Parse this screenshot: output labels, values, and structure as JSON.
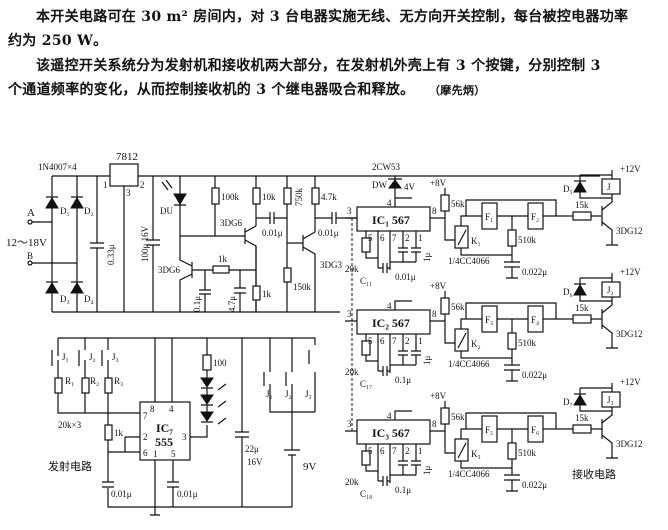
{
  "text": {
    "p1a": "本开关电路可在 30 m² 房间内，对 3 台电器实施无线、无方向开关控制，每台被控电器功率",
    "p1b": "约为 250 W。",
    "p2a": "该遥控开关系统分为发射机和接收机两大部分，在发射机外壳上有 3 个按键，分别控制 3",
    "p2b": "个通道频率的变化，从而控制接收机的 3 个继电器吸合和释放。",
    "author": "（摩先炳）"
  },
  "power": {
    "bridge": "1N4007×4",
    "regulator": "7812",
    "pin1": "1",
    "pin2": "2",
    "pin3": "3",
    "a": "A",
    "b": "B",
    "input_voltage": "12～18V",
    "d1": "D₁",
    "d2": "D₂",
    "d3": "D₃",
    "d4": "D₄",
    "c033": "0.33μ",
    "c100": "100μ 16V",
    "du": "DU",
    "r100k": "100k",
    "r10k": "10k",
    "r750k": "750k",
    "r47k": "4.7k",
    "q1": "3DG6",
    "q2": "3DG6",
    "q3": "3DG3",
    "c001a": "0.01μ",
    "c001b": "0.01μ",
    "r1k_h": "1k",
    "c01": "0.1μ",
    "c47": "4.7μ",
    "r1k_v": "1k",
    "r150k": "150k"
  },
  "receiver": {
    "zener": "2CW53",
    "dw": "DW",
    "zener_v": "4V",
    "caption": "接收电路",
    "rows": [
      {
        "ic": "IC₁ 567",
        "supply": "+8V",
        "p3": "3",
        "p8": "8",
        "p4": "4",
        "p5": "5",
        "p6": "6",
        "p7": "7",
        "p2": "2",
        "p1": "1",
        "pot": "20k",
        "c_timing": "C₁₁",
        "c_bottom": "0.01μ",
        "c_side": "1μ",
        "r56k": "56k",
        "k": "K₁",
        "fa": "F₁",
        "fb": "F₂",
        "r510k": "510k",
        "switch_ic": "1/4CC4066",
        "c022": "0.022μ",
        "r15k": "15k",
        "transistor": "3DG12",
        "diode": "D₅",
        "relay": "J",
        "relay_v": "+12V"
      },
      {
        "ic": "IC₂ 567",
        "supply": "+8V",
        "p3": "3",
        "p8": "8",
        "p4": "4",
        "p5": "5",
        "p6": "6",
        "p7": "7",
        "p2": "2",
        "p1": "1",
        "pot": "20k",
        "c_timing": "C₁₇",
        "c_bottom": "0.1μ",
        "c_side": "1μ",
        "r56k": "56k",
        "k": "K₂",
        "fa": "F₃",
        "fb": "F₄",
        "r510k": "510k",
        "switch_ic": "1/4CC4066",
        "c022": "0.022μ",
        "r15k": "15k",
        "transistor": "3DG12",
        "diode": "D₆",
        "relay": "J₂",
        "relay_v": "+12V"
      },
      {
        "ic": "IC₃ 567",
        "supply": "+8V",
        "p3": "3",
        "p8": "8",
        "p4": "4",
        "p5": "5",
        "p6": "6",
        "p7": "7",
        "p2": "2",
        "p1": "1",
        "pot": "20k",
        "c_timing": "C₁₈",
        "c_bottom": "0.1μ",
        "c_side": "1μ",
        "r56k": "56k",
        "k": "K₃",
        "fa": "F₅",
        "fb": "F₆",
        "r510k": "510k",
        "switch_ic": "1/4CC4066",
        "c022": "0.022μ",
        "r15k": "15k",
        "transistor": "3DG12",
        "diode": "D₇",
        "relay": "J₃",
        "relay_v": "+12V"
      }
    ]
  },
  "transmitter": {
    "caption": "发射电路",
    "j1": "J₁",
    "j2": "J₂",
    "j3": "J₃",
    "r1": "R₁",
    "r2": "R₂",
    "r3": "R₃",
    "pots": "20k×3",
    "r1k": "1k",
    "ic": "IC₇",
    "ic_type": "555",
    "p8": "8",
    "p4": "4",
    "p7": "7",
    "p2": "2",
    "p6": "6",
    "p1": "1",
    "p5": "5",
    "p3": "3",
    "r100": "100",
    "c22": "22μ",
    "c22v": "16V",
    "battery": "9V",
    "c001a": "0.01μ",
    "c001b": "0.01μ",
    "sj1": "J₁",
    "sj2": "J₂",
    "sj3": "J₃"
  }
}
